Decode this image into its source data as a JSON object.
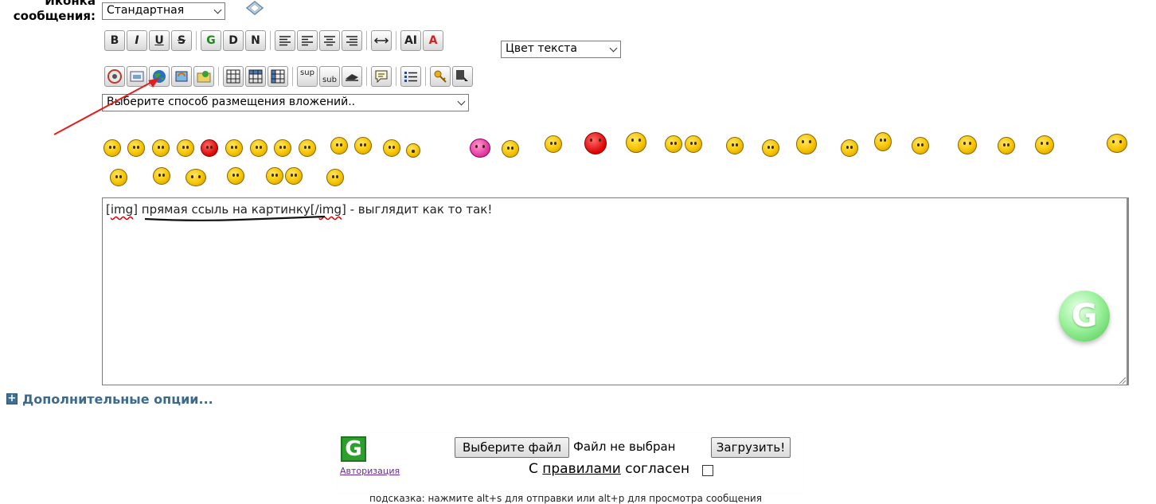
{
  "message_icon": {
    "label": "Иконка сообщения:",
    "selected": "Стандартная"
  },
  "toolbar_row1": {
    "buttons": [
      "B",
      "I",
      "U",
      "S",
      "G",
      "D",
      "N",
      "align-left",
      "align-left",
      "align-center",
      "align-right",
      "width",
      "AI",
      "A"
    ],
    "text_color_selected": "Цвет текста"
  },
  "toolbar_row2": {
    "buttons": [
      "sup",
      "sub"
    ]
  },
  "attachment_select": {
    "selected": "Выберите способ размещения вложений.."
  },
  "editor": {
    "seg_open": "[",
    "seg_img1": "img",
    "seg_close1": "] ",
    "seg_link": "прямая ссыль на картинку",
    "seg_open2": "[/",
    "seg_img2": "img",
    "seg_close2": "] - выглядит как то так!"
  },
  "grammarly_letter": "G",
  "extra_options": {
    "label": "Дополнительные опции..."
  },
  "upload": {
    "logo_letter": "G",
    "auth_link": "Авторизация",
    "choose_file": "Выберите файл",
    "no_file": "Файл не выбран",
    "upload_button": "Загрузить!",
    "rules_prefix": "С ",
    "rules_link": "правилами",
    "rules_suffix": " согласен"
  },
  "hint": "подсказка: нажмите alt+s для отправки или alt+p для просмотра сообщения",
  "colors": {
    "link_blue": "#3e6a8a",
    "arrow_red": "#e02020",
    "visited_purple": "#6a2a9a"
  }
}
